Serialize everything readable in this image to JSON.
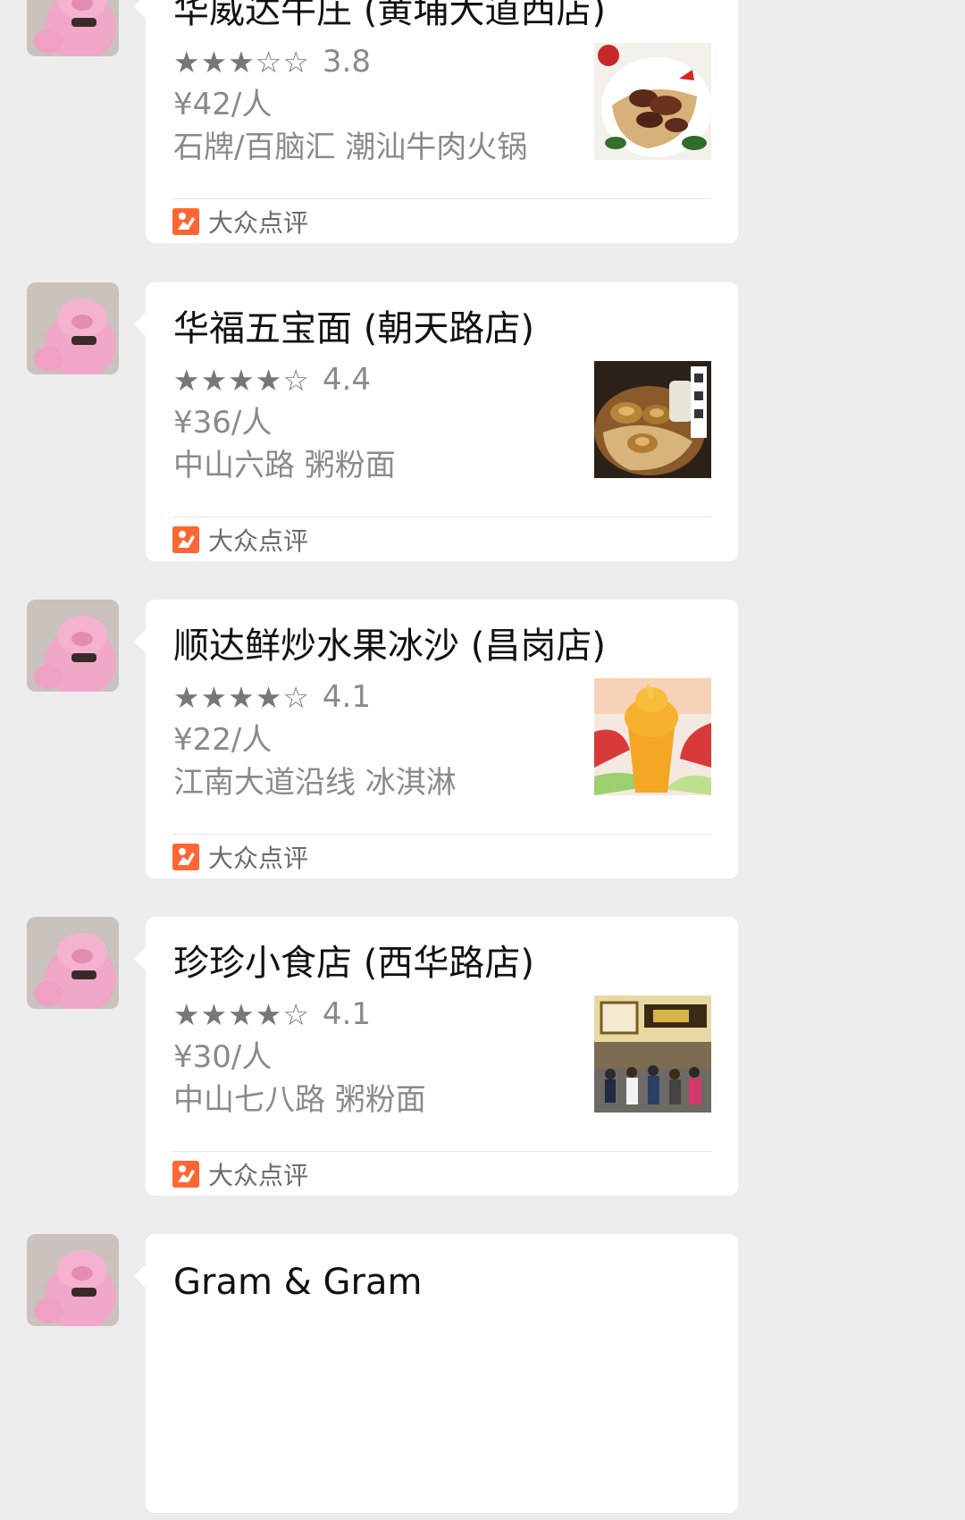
{
  "chat": {
    "messages": [
      {
        "shop_name": "华威达牛庄 (黄埔大道西店)",
        "stars": "★★★☆☆",
        "rating": "3.8",
        "price": "¥42/人",
        "meta": "石牌/百脑汇 潮汕牛肉火锅",
        "source": "大众点评",
        "thumb_icon": "beef-noodle-photo"
      },
      {
        "shop_name": "华福五宝面 (朝天路店)",
        "stars": "★★★★☆",
        "rating": "4.4",
        "price": "¥36/人",
        "meta": "中山六路 粥粉面",
        "source": "大众点评",
        "thumb_icon": "abalone-noodle-photo"
      },
      {
        "shop_name": "顺达鲜炒水果冰沙 (昌岗店)",
        "stars": "★★★★☆",
        "rating": "4.1",
        "price": "¥22/人",
        "meta": "江南大道沿线 冰淇淋",
        "source": "大众点评",
        "thumb_icon": "mango-smoothie-photo"
      },
      {
        "shop_name": "珍珍小食店 (西华路店)",
        "stars": "★★★★☆",
        "rating": "4.1",
        "price": "¥30/人",
        "meta": "中山七八路 粥粉面",
        "source": "大众点评",
        "thumb_icon": "storefront-crowd-photo"
      },
      {
        "shop_name": "Gram & Gram"
      }
    ]
  },
  "colors": {
    "background": "#ededed",
    "bubble": "#ffffff",
    "dianping_orange": "#ff6633",
    "star_gray": "#777777",
    "secondary_text": "#8a8a8a"
  }
}
